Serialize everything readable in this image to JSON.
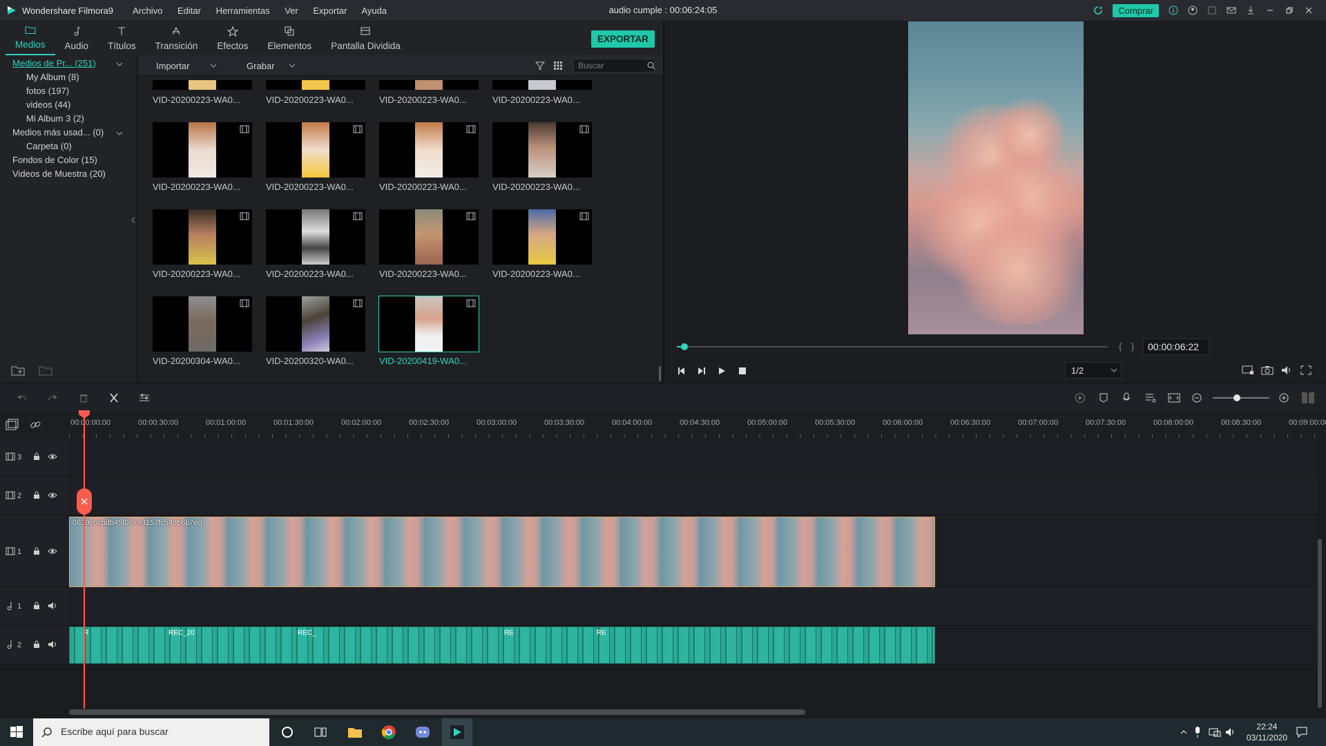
{
  "window": {
    "app_name": "Wondershare Filmora9",
    "project_title": "audio cumple : 00:06:24:05",
    "menu": [
      "Archivo",
      "Editar",
      "Herramientas",
      "Ver",
      "Exportar",
      "Ayuda"
    ],
    "buy_label": "Comprar"
  },
  "tabs": [
    {
      "label": "Medios",
      "icon": "folder-icon",
      "active": true
    },
    {
      "label": "Audio",
      "icon": "music-note-icon"
    },
    {
      "label": "Títulos",
      "icon": "text-icon"
    },
    {
      "label": "Transición",
      "icon": "transition-icon"
    },
    {
      "label": "Efectos",
      "icon": "effects-icon"
    },
    {
      "label": "Elementos",
      "icon": "elements-icon"
    },
    {
      "label": "Pantalla Dividida",
      "icon": "split-screen-icon"
    }
  ],
  "export_label": "EXPORTAR",
  "library": {
    "items": [
      {
        "label": "Medios de Pr... (251)",
        "active": true,
        "expandable": true
      },
      {
        "label": "My Album (8)",
        "sub": true
      },
      {
        "label": "fotos (197)",
        "sub": true
      },
      {
        "label": "videos (44)",
        "sub": true
      },
      {
        "label": "Mi Album 3 (2)",
        "sub": true
      },
      {
        "label": "Medios más usad... (0)",
        "expandable": true
      },
      {
        "label": "Carpeta (0)",
        "sub": true
      },
      {
        "label": "Fondos de Color (15)"
      },
      {
        "label": "Videos de Muestra (20)"
      }
    ]
  },
  "media": {
    "import_label": "Importar",
    "record_label": "Grabar",
    "search_placeholder": "Buscar",
    "clips": [
      "VID-20200223-WA0...",
      "VID-20200223-WA0...",
      "VID-20200223-WA0...",
      "VID-20200223-WA0...",
      "VID-20200223-WA0...",
      "VID-20200223-WA0...",
      "VID-20200223-WA0...",
      "VID-20200223-WA0...",
      "VID-20200223-WA0...",
      "VID-20200223-WA0...",
      "VID-20200223-WA0...",
      "VID-20200223-WA0...",
      "VID-20200304-WA0...",
      "VID-20200320-WA0...",
      "VID-20200419-WA0..."
    ],
    "selected_index": 14
  },
  "preview": {
    "timecode": "00:00:06:22",
    "quality": "1/2",
    "progress": 0.01
  },
  "timeline": {
    "ruler": [
      "00:00:00:00",
      "00:00:30:00",
      "00:01:00:00",
      "00:01:30:00",
      "00:02:00:00",
      "00:02:30:00",
      "00:03:00:00",
      "00:03:30:00",
      "00:04:00:00",
      "00:04:30:00",
      "00:05:00:00",
      "00:05:30:00",
      "00:06:00:00",
      "00:06:30:00",
      "00:07:00:00",
      "00:07:30:00",
      "00:08:00:00",
      "00:08:30:00",
      "00:09:00:00"
    ],
    "tracks": [
      {
        "id": "3",
        "type": "video"
      },
      {
        "id": "2",
        "type": "video"
      },
      {
        "id": "1",
        "type": "video"
      },
      {
        "id": "1",
        "type": "audio"
      },
      {
        "id": "2",
        "type": "audio"
      }
    ],
    "video_clip_name": "0639c6cbdb45f067e3157fc548b6b7ed",
    "audio_segments": [
      "R",
      "REC_20",
      "REC_",
      "RE",
      "RE"
    ]
  },
  "taskbar": {
    "search_placeholder": "Escribe aquí para buscar",
    "time": "22:24",
    "date": "03/11/2020"
  }
}
